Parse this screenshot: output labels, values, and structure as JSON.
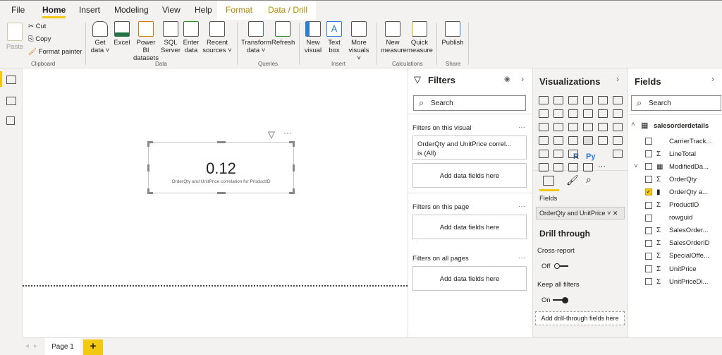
{
  "tabs": [
    "File",
    "Home",
    "Insert",
    "Modeling",
    "View",
    "Help",
    "Format",
    "Data / Drill"
  ],
  "ribbon": {
    "clipboard": {
      "paste": "Paste",
      "cut": "Cut",
      "copy": "Copy",
      "format_painter": "Format painter",
      "label": "Clipboard"
    },
    "data": {
      "get_data": "Get data ˅",
      "excel": "Excel",
      "powerbi": "Power BI datasets",
      "sql": "SQL Server",
      "enter": "Enter data",
      "recent": "Recent sources ˅",
      "label": "Data"
    },
    "queries": {
      "transform": "Transform data ˅",
      "refresh": "Refresh",
      "label": "Queries"
    },
    "insert": {
      "new_visual": "New visual",
      "text_box": "Text box",
      "more_visuals": "More visuals ˅",
      "label": "Insert"
    },
    "calculations": {
      "new_measure": "New measure",
      "quick_measure": "Quick measure",
      "label": "Calculations"
    },
    "share": {
      "publish": "Publish",
      "label": "Share"
    }
  },
  "card": {
    "value": "0.12",
    "caption": "OrderQty and UnitPrice correlation for ProductID"
  },
  "pages": {
    "page1": "Page 1",
    "add": "+"
  },
  "filters": {
    "title": "Filters",
    "search": "Search",
    "on_visual": "Filters on this visual",
    "filter_name": "OrderQty and UnitPrice correl...",
    "filter_state": "is (All)",
    "add": "Add data fields here",
    "on_page": "Filters on this page",
    "on_all": "Filters on all pages"
  },
  "viz": {
    "title": "Visualizations",
    "fields_label": "Fields",
    "field_value": "OrderQty and UnitPrice",
    "drill_title": "Drill through",
    "cross_report": "Cross-report",
    "off": "Off",
    "keep_all": "Keep all filters",
    "on": "On",
    "add_drill": "Add drill-through fields here",
    "r": "R",
    "py": "Py"
  },
  "fields": {
    "title": "Fields",
    "search": "Search",
    "table": "salesorderdetails",
    "items": [
      {
        "name": "CarrierTrack...",
        "type": "",
        "checked": false
      },
      {
        "name": "LineTotal",
        "type": "Σ",
        "checked": false
      },
      {
        "name": "ModifiedDa...",
        "type": "▦",
        "checked": false
      },
      {
        "name": "OrderQty",
        "type": "Σ",
        "checked": false
      },
      {
        "name": "OrderQty a...",
        "type": "▮",
        "checked": true
      },
      {
        "name": "ProductID",
        "type": "Σ",
        "checked": false
      },
      {
        "name": "rowguid",
        "type": "",
        "checked": false
      },
      {
        "name": "SalesOrder...",
        "type": "Σ",
        "checked": false
      },
      {
        "name": "SalesOrderID",
        "type": "Σ",
        "checked": false
      },
      {
        "name": "SpecialOffe...",
        "type": "Σ",
        "checked": false
      },
      {
        "name": "UnitPrice",
        "type": "Σ",
        "checked": false
      },
      {
        "name": "UnitPriceDi...",
        "type": "Σ",
        "checked": false
      }
    ]
  },
  "colors": {
    "accent": "#f2c811",
    "context_tab": "#b38a00"
  }
}
